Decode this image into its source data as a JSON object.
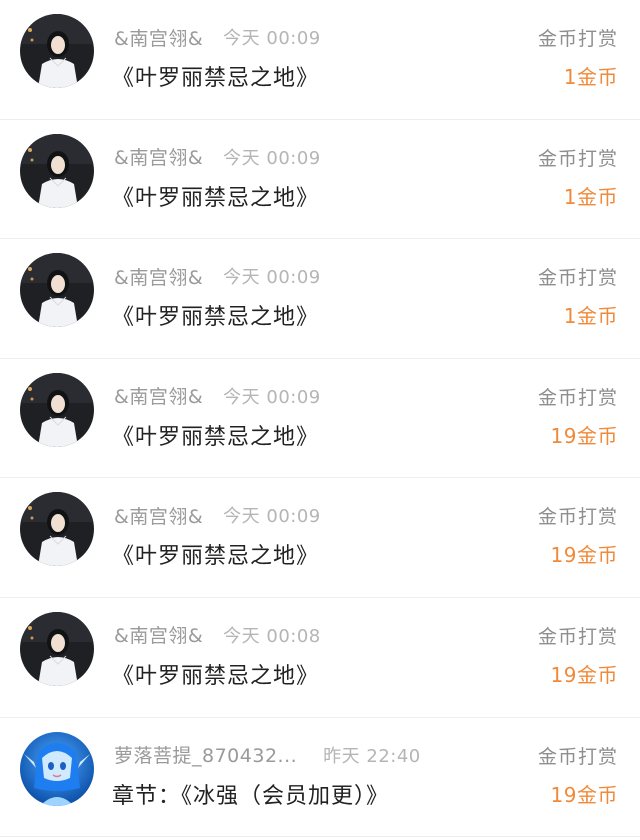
{
  "tips": [
    {
      "avatar": "woman-in-white-portrait",
      "username": "&南宫翎&",
      "time": "今天 00:09",
      "content": "《叶罗丽禁忌之地》",
      "reward_type": "金币打赏",
      "reward_amount": "1金币"
    },
    {
      "avatar": "woman-in-white-portrait",
      "username": "&南宫翎&",
      "time": "今天 00:09",
      "content": "《叶罗丽禁忌之地》",
      "reward_type": "金币打赏",
      "reward_amount": "1金币"
    },
    {
      "avatar": "woman-in-white-portrait",
      "username": "&南宫翎&",
      "time": "今天 00:09",
      "content": "《叶罗丽禁忌之地》",
      "reward_type": "金币打赏",
      "reward_amount": "1金币"
    },
    {
      "avatar": "woman-in-white-portrait",
      "username": "&南宫翎&",
      "time": "今天 00:09",
      "content": "《叶罗丽禁忌之地》",
      "reward_type": "金币打赏",
      "reward_amount": "19金币"
    },
    {
      "avatar": "woman-in-white-portrait",
      "username": "&南宫翎&",
      "time": "今天 00:09",
      "content": "《叶罗丽禁忌之地》",
      "reward_type": "金币打赏",
      "reward_amount": "19金币"
    },
    {
      "avatar": "woman-in-white-portrait",
      "username": "&南宫翎&",
      "time": "今天 00:08",
      "content": "《叶罗丽禁忌之地》",
      "reward_type": "金币打赏",
      "reward_amount": "19金币"
    },
    {
      "avatar": "blue-haired-elf-portrait",
      "username": "萝落菩提_870432...",
      "time": "昨天 22:40",
      "content": "章节：《冰强（会员加更）》",
      "reward_type": "金币打赏",
      "reward_amount": "19金币"
    }
  ],
  "colors": {
    "reward_amount": "#f08a3a",
    "username": "#9a9a9a",
    "time": "#b5b5b5",
    "content": "#222222",
    "reward_type": "#8e8e8e",
    "divider": "#eeeeee"
  }
}
